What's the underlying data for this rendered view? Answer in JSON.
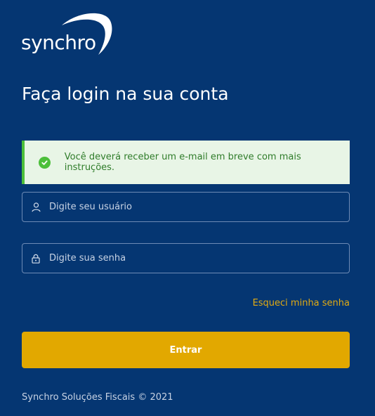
{
  "brand": {
    "name": "synchro"
  },
  "login": {
    "title": "Faça login na sua conta",
    "alert_message": "Você deverá receber um e-mail em breve com mais instruções.",
    "username_placeholder": "Digite seu usuário",
    "username_value": "",
    "password_placeholder": "Digite sua senha",
    "password_value": "",
    "forgot_link": "Esqueci minha senha",
    "submit_label": "Entrar"
  },
  "footer": {
    "copyright": "Synchro Soluções Fiscais © 2021"
  },
  "colors": {
    "background": "#053672",
    "accent": "#e2a800",
    "success": "#4cbf3a"
  },
  "icons": {
    "alert": "check-circle-icon",
    "username": "user-icon",
    "password": "lock-icon"
  }
}
